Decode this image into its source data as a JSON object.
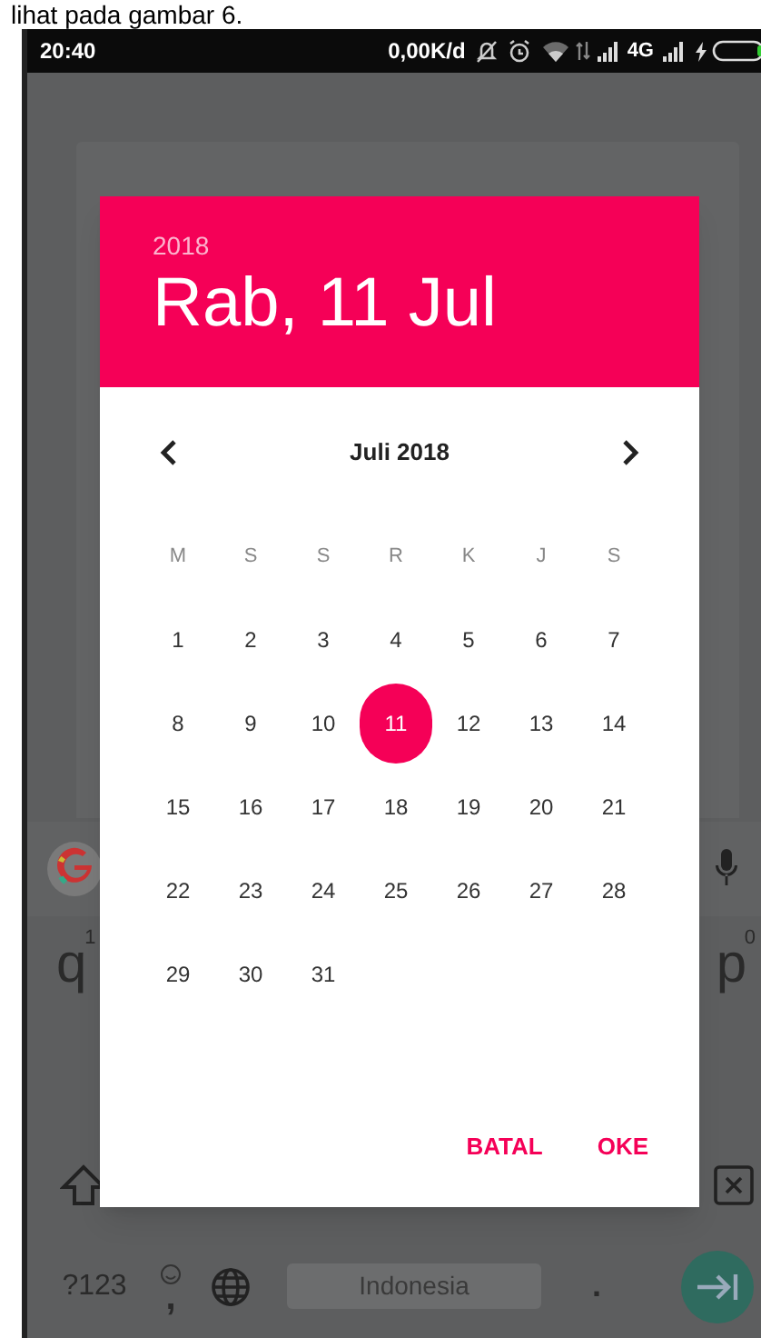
{
  "caption": "lihat pada gambar 6.",
  "status_bar": {
    "time": "20:40",
    "speed": "0,00K/d",
    "network": "4G"
  },
  "keyboard": {
    "keys_row_1": [
      {
        "label": "q",
        "hint": "1"
      },
      {
        "label": "p",
        "hint": "0"
      }
    ],
    "bottom_row": {
      "symbols": "?123",
      "comma": ",",
      "space": "Indonesia",
      "period": "."
    }
  },
  "dialog": {
    "year": "2018",
    "date": "Rab, 11 Jul",
    "month": "Juli 2018",
    "weekdays": [
      "M",
      "S",
      "S",
      "R",
      "K",
      "J",
      "S"
    ],
    "weeks": [
      [
        {
          "label": "1",
          "selected": false
        },
        {
          "label": "2",
          "selected": false
        },
        {
          "label": "3",
          "selected": false
        },
        {
          "label": "4",
          "selected": false
        },
        {
          "label": "5",
          "selected": false
        },
        {
          "label": "6",
          "selected": false
        },
        {
          "label": "7",
          "selected": false
        }
      ],
      [
        {
          "label": "8",
          "selected": false
        },
        {
          "label": "9",
          "selected": false
        },
        {
          "label": "10",
          "selected": false
        },
        {
          "label": "11",
          "selected": true
        },
        {
          "label": "12",
          "selected": false
        },
        {
          "label": "13",
          "selected": false
        },
        {
          "label": "14",
          "selected": false
        }
      ],
      [
        {
          "label": "15",
          "selected": false
        },
        {
          "label": "16",
          "selected": false
        },
        {
          "label": "17",
          "selected": false
        },
        {
          "label": "18",
          "selected": false
        },
        {
          "label": "19",
          "selected": false
        },
        {
          "label": "20",
          "selected": false
        },
        {
          "label": "21",
          "selected": false
        }
      ],
      [
        {
          "label": "22",
          "selected": false
        },
        {
          "label": "23",
          "selected": false
        },
        {
          "label": "24",
          "selected": false
        },
        {
          "label": "25",
          "selected": false
        },
        {
          "label": "26",
          "selected": false
        },
        {
          "label": "27",
          "selected": false
        },
        {
          "label": "28",
          "selected": false
        }
      ],
      [
        {
          "label": "29",
          "selected": false
        },
        {
          "label": "30",
          "selected": false
        },
        {
          "label": "31",
          "selected": false
        }
      ]
    ],
    "buttons": [
      "BATAL",
      "OKE"
    ]
  }
}
